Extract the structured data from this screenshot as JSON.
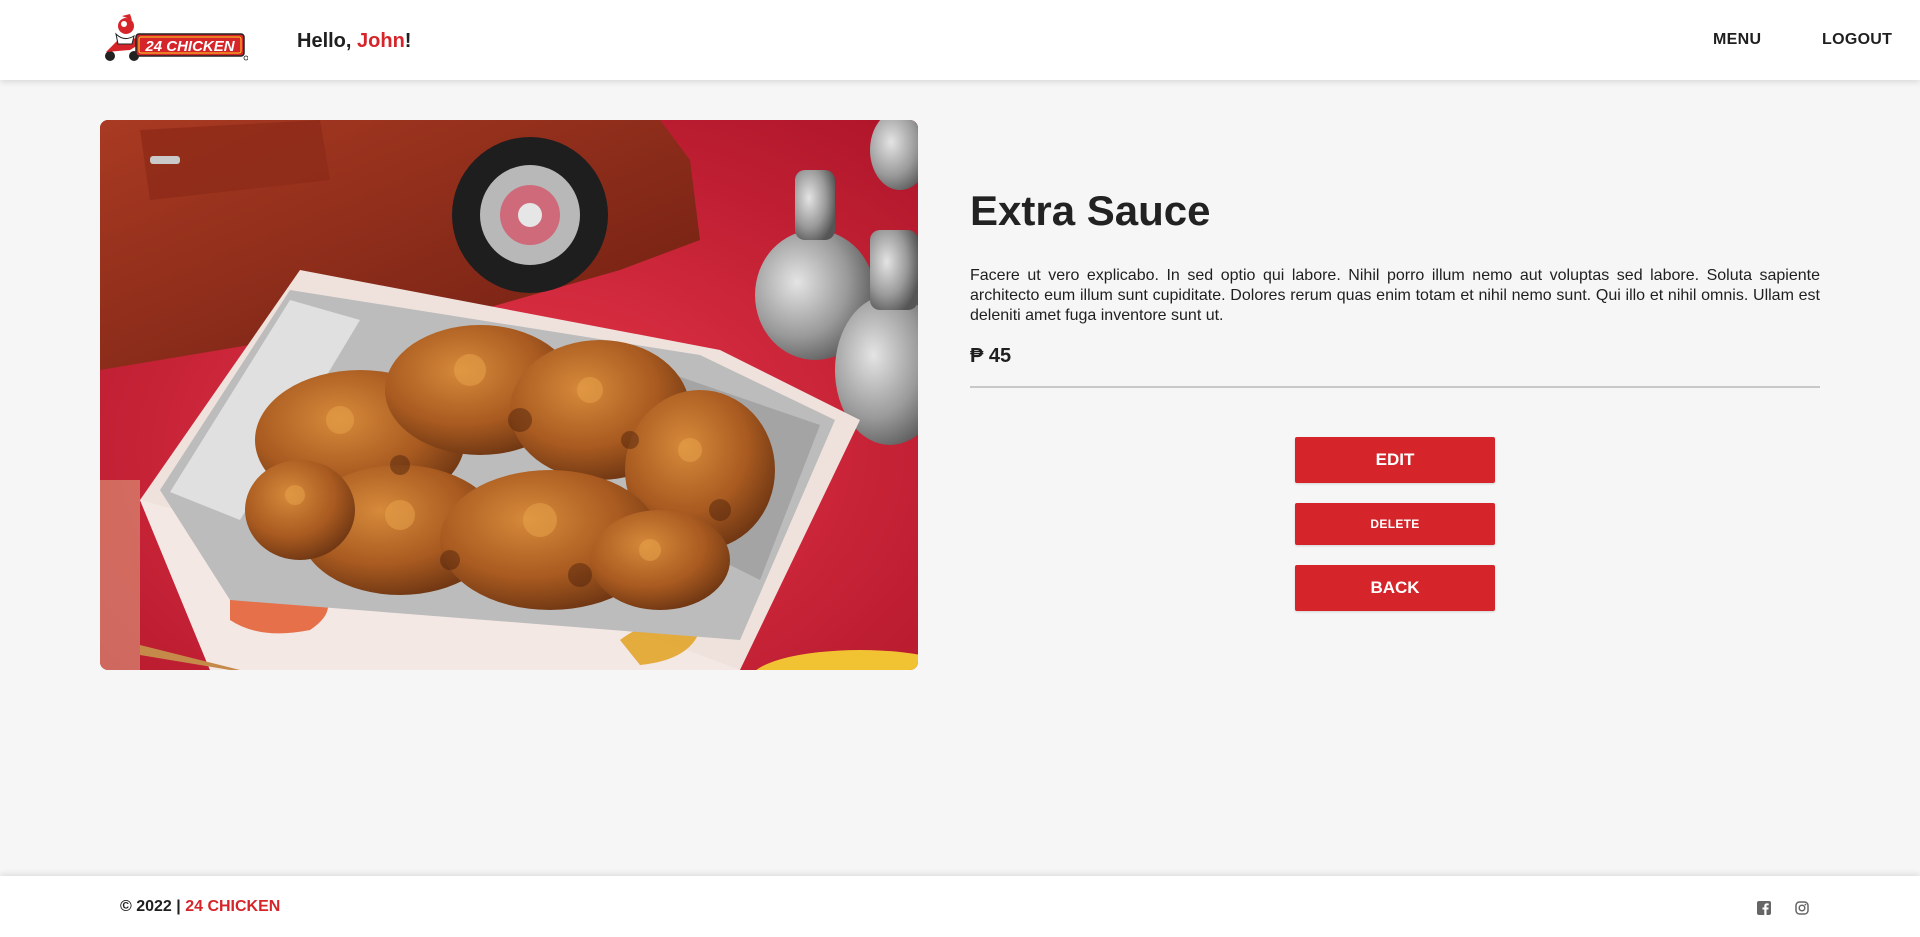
{
  "header": {
    "brand": "24 CHICKEN",
    "greeting_prefix": "Hello, ",
    "user_name": "John",
    "greeting_suffix": "!",
    "nav": {
      "menu": "MENU",
      "logout": "LOGOUT"
    }
  },
  "product": {
    "title": "Extra Sauce",
    "description": "Facere ut vero explicabo. In sed optio qui labore. Nihil porro illum nemo aut voluptas sed labore. Soluta sapiente architecto eum illum sunt cupiditate. Dolores rerum quas enim totam et nihil nemo sunt. Qui illo et nihil omnis. Ullam est deleniti amet fuga inventore sunt ut.",
    "price": "₱ 45"
  },
  "actions": {
    "edit": "EDIT",
    "delete": "DELETE",
    "back": "BACK"
  },
  "footer": {
    "copyright_prefix": "© 2022 | ",
    "brand": "24 CHICKEN",
    "social": [
      "facebook-icon",
      "instagram-icon"
    ]
  },
  "colors": {
    "accent": "#d6252a",
    "background": "#f6f6f6",
    "surface": "#ffffff"
  }
}
